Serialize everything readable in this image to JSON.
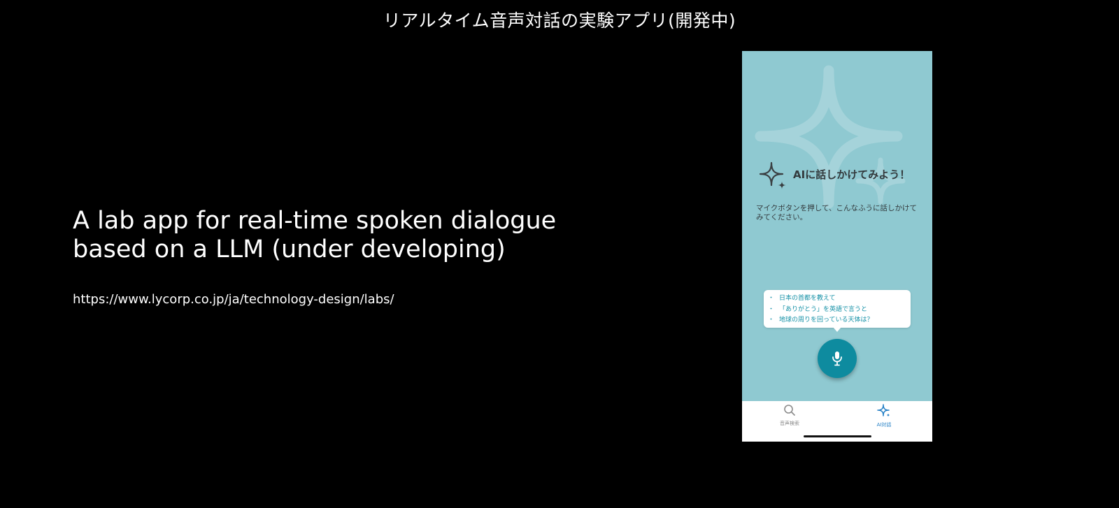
{
  "slide": {
    "title": "リアルタイム音声対話の実験アプリ(開発中)",
    "headline_line1": "A lab app for real-time spoken dialogue",
    "headline_line2": "based on a LLM (under developing)",
    "url": "https://www.lycorp.co.jp/ja/technology-design/labs/"
  },
  "app": {
    "heading": "AIに話しかけてみよう！",
    "instruction": "マイクボタンを押して、こんなふうに話しかけてみてください。",
    "suggestions": [
      "日本の首都を教えて",
      "「ありがとう」を英語で言うと",
      "地球の周りを回っている天体は？"
    ],
    "tabs": [
      {
        "label": "音声検索",
        "icon": "search-icon",
        "active": false
      },
      {
        "label": "AI対話",
        "icon": "sparkle-icon",
        "active": true
      }
    ],
    "colors": {
      "screen_bg": "#8fc9d1",
      "mic_button": "#0e8b9f",
      "suggestion_text": "#1390a6",
      "active_tab": "#1e7cc4"
    }
  }
}
